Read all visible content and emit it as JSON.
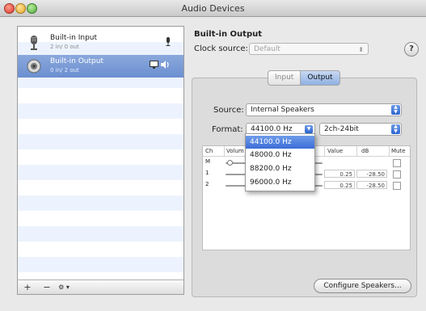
{
  "window": {
    "title": "Audio Devices"
  },
  "sidebar": {
    "devices": [
      {
        "name": "Built-in Input",
        "sub": "2 in/ 0 out",
        "icon": "microphone-icon",
        "selected": false
      },
      {
        "name": "Built-in Output",
        "sub": "0 in/ 2 out",
        "icon": "speaker-icon",
        "selected": true
      }
    ],
    "toolbar": {
      "add": "+",
      "remove": "−",
      "action": "⚙ ▾"
    }
  },
  "main": {
    "section_title": "Built-in Output",
    "clock_source": {
      "label": "Clock source:",
      "value": "Default"
    },
    "help": "?",
    "tabs": [
      {
        "label": "Input",
        "active": false
      },
      {
        "label": "Output",
        "active": true
      }
    ],
    "source": {
      "label": "Source:",
      "value": "Internal Speakers"
    },
    "format": {
      "label": "Format:",
      "value": "44100.0 Hz",
      "bit_depth": "2ch-24bit",
      "options": [
        "44100.0 Hz",
        "48000.0 Hz",
        "88200.0 Hz",
        "96000.0 Hz"
      ]
    },
    "table": {
      "headers": {
        "ch": "Ch",
        "volume": "Volum",
        "value": "Value",
        "db": "dB",
        "mute": "Mute"
      },
      "rows": [
        {
          "ch": "M",
          "value": "",
          "db": ""
        },
        {
          "ch": "1",
          "value": "0.25",
          "db": "-28.50"
        },
        {
          "ch": "2",
          "value": "0.25",
          "db": "-28.50"
        }
      ]
    },
    "configure_button": "Configure Speakers..."
  },
  "colors": {
    "accent": "#3a6dd6",
    "selection": "#6b8fd0"
  }
}
